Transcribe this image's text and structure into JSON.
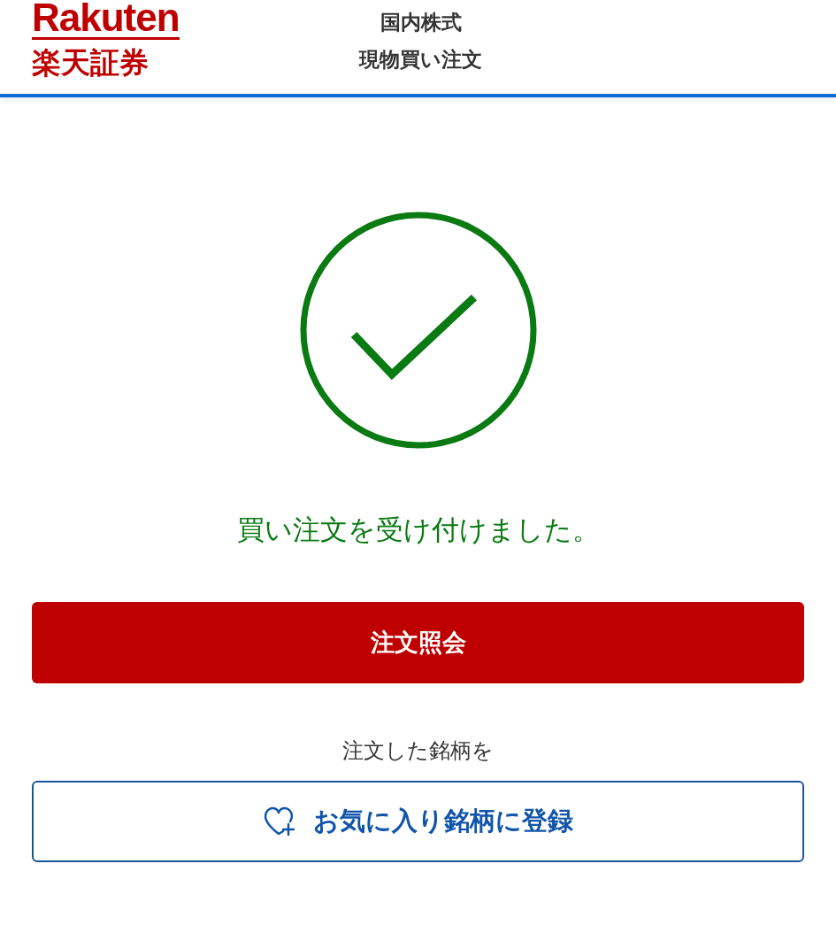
{
  "header": {
    "logo": {
      "wordmark": "Rakuten",
      "name": "楽天証券"
    },
    "title_lines": [
      "国内株式",
      "現物買い注文"
    ]
  },
  "result": {
    "message": "買い注文を受け付けました。"
  },
  "actions": [
    {
      "kind": "primary",
      "label": "注文照会"
    },
    {
      "kind": "caption",
      "label": "注文した銘柄を"
    },
    {
      "kind": "outline",
      "label": "お気に入り銘柄に登録"
    }
  ]
}
